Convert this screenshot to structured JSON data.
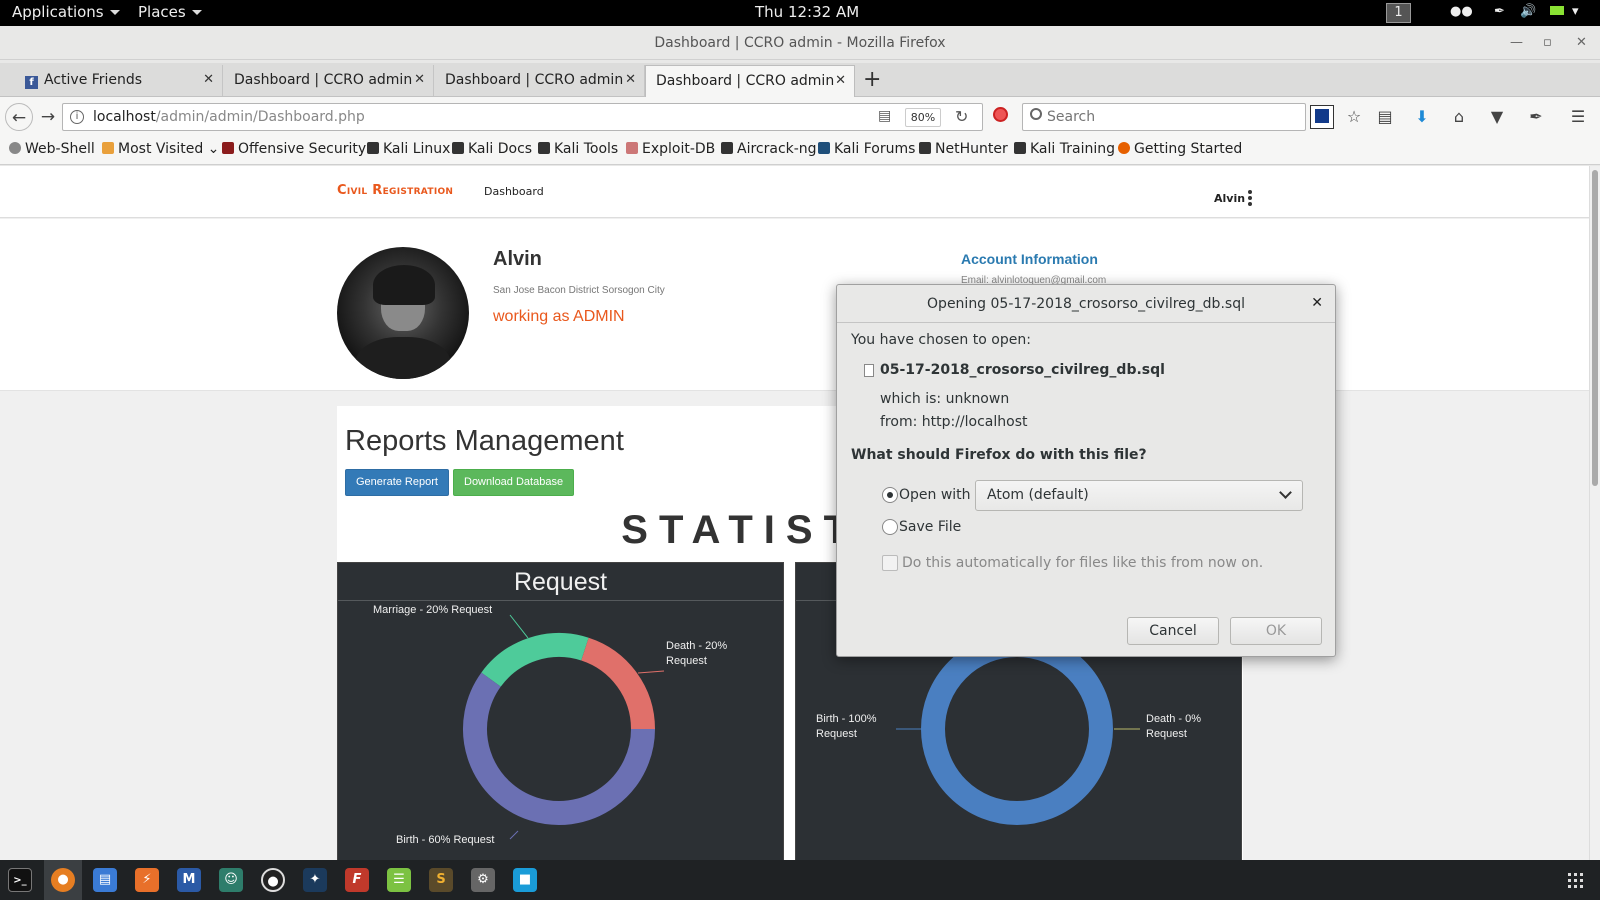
{
  "topbar": {
    "applications": "Applications",
    "places": "Places",
    "clock": "Thu 12:32 AM",
    "workspace": "1"
  },
  "window": {
    "title": "Dashboard | CCRO admin - Mozilla Firefox"
  },
  "tabs": [
    {
      "label": "Active Friends"
    },
    {
      "label": "Dashboard | CCRO admin"
    },
    {
      "label": "Dashboard | CCRO admin"
    },
    {
      "label": "Dashboard | CCRO admin"
    }
  ],
  "navbar": {
    "url_host": "localhost",
    "url_path": "/admin/admin/Dashboard.php",
    "zoom": "80%",
    "search_placeholder": "Search"
  },
  "bookmarks": [
    {
      "label": "Web-Shell"
    },
    {
      "label": "Most Visited"
    },
    {
      "label": "Offensive Security"
    },
    {
      "label": "Kali Linux"
    },
    {
      "label": "Kali Docs"
    },
    {
      "label": "Kali Tools"
    },
    {
      "label": "Exploit-DB"
    },
    {
      "label": "Aircrack-ng"
    },
    {
      "label": "Kali Forums"
    },
    {
      "label": "NetHunter"
    },
    {
      "label": "Kali Training"
    },
    {
      "label": "Getting Started"
    }
  ],
  "site": {
    "brand": "Civil Registration",
    "nav_dashboard": "Dashboard",
    "user": "Alvin"
  },
  "profile": {
    "name": "Alvin",
    "address": "San Jose Bacon District Sorsogon City",
    "role": "working as ADMIN",
    "account_heading": "Account Information",
    "email_partial": "Email: alvinlotoquen@gmail.com"
  },
  "reports": {
    "title": "Reports Management",
    "generate_btn": "Generate Report",
    "download_btn": "Download Database",
    "statistics": "STATISTICS"
  },
  "chart_data": [
    {
      "type": "pie",
      "title": "Request",
      "categories": [
        "Marriage",
        "Death",
        "Birth"
      ],
      "values": [
        20,
        20,
        60
      ],
      "labels": [
        "Marriage - 20% Request",
        "Death - 20% Request",
        "Birth - 60% Request"
      ],
      "colors": [
        "#4ecb9a",
        "#e0706a",
        "#6b70b3"
      ]
    },
    {
      "type": "pie",
      "title": "",
      "categories": [
        "Birth",
        "Death"
      ],
      "values": [
        100,
        0
      ],
      "labels": [
        "Birth - 100% Request",
        "Death - 0% Request"
      ],
      "colors": [
        "#4a7fc1",
        "#b8b86a"
      ]
    }
  ],
  "dialog": {
    "title": "Opening 05-17-2018_crosorso_civilreg_db.sql",
    "chosen": "You have chosen to open:",
    "filename": "05-17-2018_crosorso_civilreg_db.sql",
    "which_is": "which is:  unknown",
    "from": "from:  http://localhost",
    "question": "What should Firefox do with this file?",
    "open_with": "Open with",
    "app": "Atom (default)",
    "save_file": "Save File",
    "auto": "Do this automatically for files like this from now on.",
    "cancel": "Cancel",
    "ok": "OK"
  }
}
